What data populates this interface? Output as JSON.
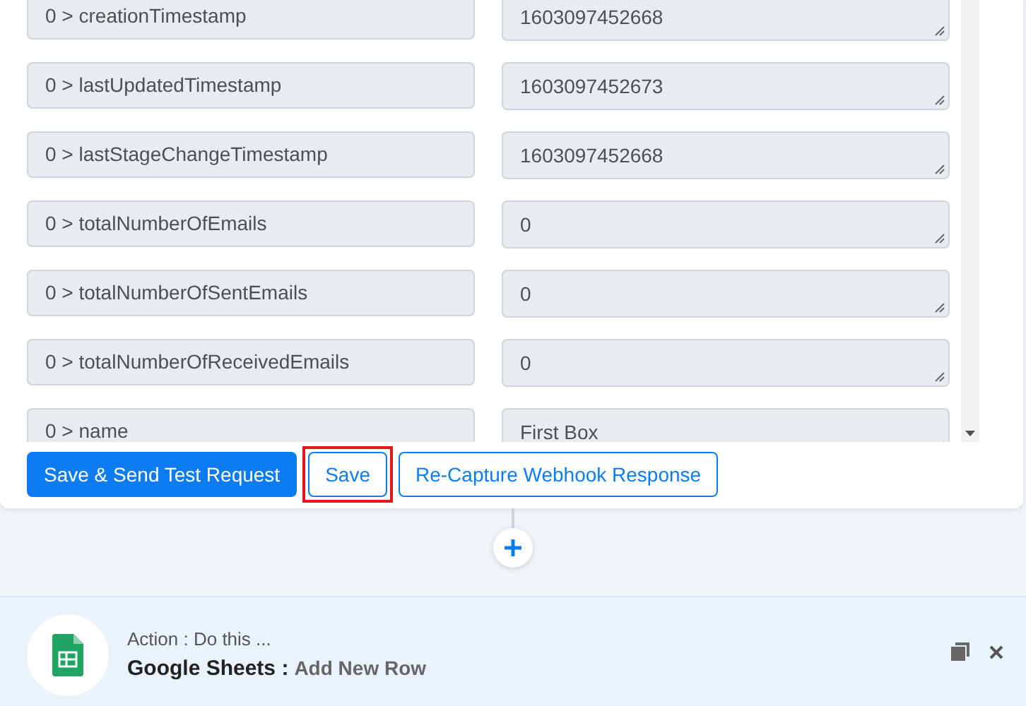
{
  "fields": [
    {
      "key": "0 > creationTimestamp",
      "value": "1603097452668"
    },
    {
      "key": "0 > lastUpdatedTimestamp",
      "value": "1603097452673"
    },
    {
      "key": "0 > lastStageChangeTimestamp",
      "value": "1603097452668"
    },
    {
      "key": "0 > totalNumberOfEmails",
      "value": "0"
    },
    {
      "key": "0 > totalNumberOfSentEmails",
      "value": "0"
    },
    {
      "key": "0 > totalNumberOfReceivedEmails",
      "value": "0"
    },
    {
      "key": "0 > name",
      "value": "First Box"
    }
  ],
  "buttons": [
    {
      "label": "Save & Send Test Request",
      "kind": "primary",
      "highlighted": false
    },
    {
      "label": "Save",
      "kind": "outline",
      "highlighted": true
    },
    {
      "label": "Re-Capture Webhook Response",
      "kind": "outline",
      "highlighted": false
    }
  ],
  "action": {
    "caption": "Action : Do this ...",
    "app": "Google Sheets :",
    "event": "Add New Row"
  }
}
